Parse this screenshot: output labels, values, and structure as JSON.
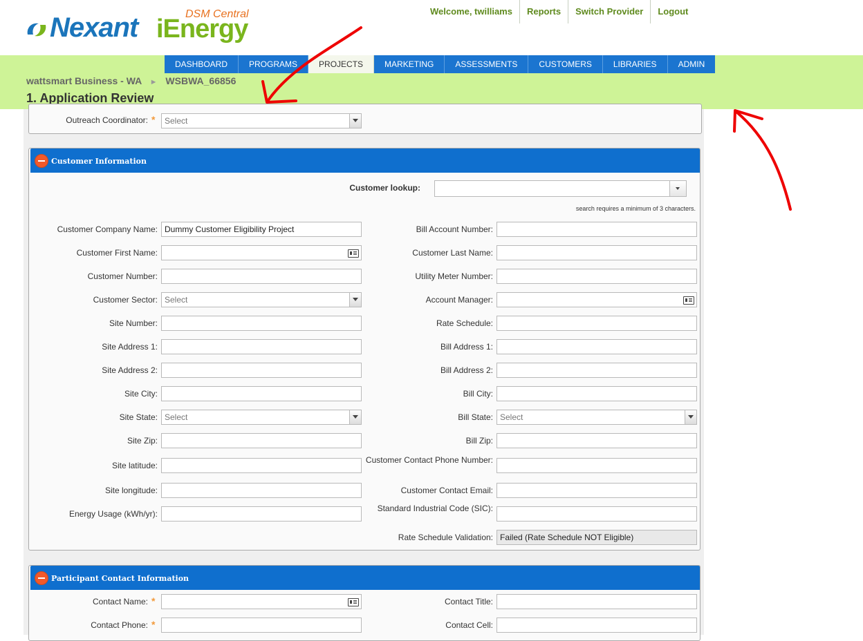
{
  "header": {
    "logo_brand": "Nexant",
    "logo_product": "iEnergy",
    "logo_tagline": "DSM Central",
    "welcome": "Welcome, twilliams",
    "links": [
      {
        "label": "Reports"
      },
      {
        "label": "Switch Provider"
      },
      {
        "label": "Logout"
      }
    ],
    "colors": {
      "band": "#cef397",
      "nav": "#1b75d0",
      "brand_blue": "#1b75bb",
      "brand_green": "#7ab51d",
      "brand_orange": "#e8711f"
    }
  },
  "nav": {
    "items": [
      "DASHBOARD",
      "PROGRAMS",
      "PROJECTS",
      "MARKETING",
      "ASSESSMENTS",
      "CUSTOMERS",
      "LIBRARIES",
      "ADMIN"
    ],
    "active": "PROJECTS"
  },
  "breadcrumb": {
    "program": "wattsmart Business - WA",
    "separator": "►",
    "project_id": "WSBWA_66856"
  },
  "page_title": "1. Application Review",
  "outreach": {
    "label": "Outreach Coordinator:",
    "value": "Select"
  },
  "customer_panel": {
    "title": "Customer Information",
    "lookup_label": "Customer lookup:",
    "lookup_value": "",
    "lookup_hint": "search requires a minimum of 3 characters.",
    "left_fields": [
      {
        "label": "Customer Company Name:",
        "required": true,
        "type": "text",
        "value": "Dummy Customer Eligibility Project"
      },
      {
        "label": "Customer First Name:",
        "required": false,
        "type": "contact",
        "value": ""
      },
      {
        "label": "Customer Number:",
        "required": true,
        "type": "text",
        "value": ""
      },
      {
        "label": "Customer Sector:",
        "required": true,
        "type": "select",
        "value": "Select"
      },
      {
        "label": "Site Number:",
        "required": true,
        "type": "text",
        "value": ""
      },
      {
        "label": "Site Address 1:",
        "required": true,
        "type": "text",
        "value": ""
      },
      {
        "label": "Site Address 2:",
        "required": false,
        "type": "text",
        "value": ""
      },
      {
        "label": "Site City:",
        "required": true,
        "type": "text",
        "value": ""
      },
      {
        "label": "Site State:",
        "required": true,
        "type": "select",
        "value": "Select"
      },
      {
        "label": "Site Zip:",
        "required": true,
        "type": "text",
        "value": ""
      },
      {
        "label": "Site latitude:",
        "required": false,
        "type": "text",
        "value": ""
      },
      {
        "label": "Site longitude:",
        "required": false,
        "type": "text",
        "value": ""
      },
      {
        "label": "Energy Usage (kWh/yr):",
        "required": false,
        "type": "text",
        "value": ""
      }
    ],
    "right_fields": [
      {
        "label": "Bill Account Number:",
        "required": true,
        "type": "text",
        "value": ""
      },
      {
        "label": "Customer Last Name:",
        "required": false,
        "type": "text",
        "value": ""
      },
      {
        "label": "Utility Meter Number:",
        "required": true,
        "type": "text",
        "value": ""
      },
      {
        "label": "Account Manager:",
        "required": false,
        "type": "contact",
        "value": ""
      },
      {
        "label": "Rate Schedule:",
        "required": true,
        "type": "text",
        "value": ""
      },
      {
        "label": "Bill Address 1:",
        "required": true,
        "type": "text",
        "value": ""
      },
      {
        "label": "Bill Address 2:",
        "required": false,
        "type": "text",
        "value": ""
      },
      {
        "label": "Bill City:",
        "required": true,
        "type": "text",
        "value": ""
      },
      {
        "label": "Bill State:",
        "required": true,
        "type": "select",
        "value": "Select"
      },
      {
        "label": "Bill Zip:",
        "required": true,
        "type": "text",
        "value": ""
      },
      {
        "label": "Customer Contact Phone Number:",
        "required": false,
        "type": "text",
        "value": ""
      },
      {
        "label": "Customer Contact Email:",
        "required": false,
        "type": "text",
        "value": ""
      },
      {
        "label": "Standard Industrial Code (SIC):",
        "required": false,
        "type": "text",
        "value": ""
      },
      {
        "label": "Rate Schedule Validation:",
        "required": true,
        "type": "readonly",
        "value": "Failed (Rate Schedule NOT Eligible)"
      }
    ]
  },
  "participant_panel": {
    "title": "Participant Contact Information",
    "left_fields": [
      {
        "label": "Contact Name:",
        "required": true,
        "type": "contact",
        "value": ""
      },
      {
        "label": "Contact Phone:",
        "required": true,
        "type": "text",
        "value": ""
      }
    ],
    "right_fields": [
      {
        "label": "Contact Title:",
        "required": true,
        "type": "text",
        "value": ""
      },
      {
        "label": "Contact Cell:",
        "required": false,
        "type": "text",
        "value": ""
      }
    ]
  },
  "annotation_color": "#ee0000"
}
